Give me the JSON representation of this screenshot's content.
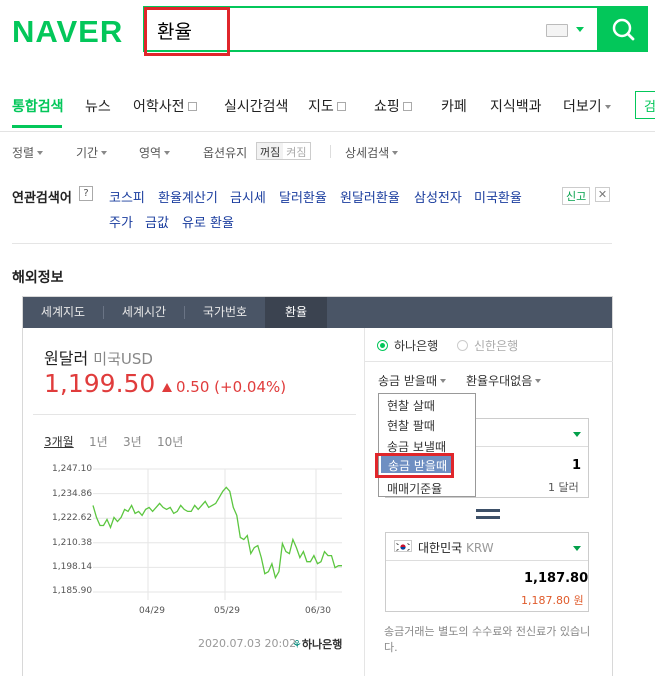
{
  "header": {
    "logo": "NAVER",
    "search_value": "환율",
    "brand_color": "#03c75a"
  },
  "nav": {
    "items": [
      {
        "label": "통합검색",
        "active": true
      },
      {
        "label": "뉴스"
      },
      {
        "label": "어학사전"
      },
      {
        "label": "실시간검색"
      },
      {
        "label": "지도"
      },
      {
        "label": "쇼핑"
      },
      {
        "label": "카페"
      },
      {
        "label": "지식백과"
      },
      {
        "label": "더보기"
      }
    ],
    "search_button_partial": "검"
  },
  "options": {
    "sort": "정렬",
    "period": "기간",
    "area": "영역",
    "keep_option": "옵션유지",
    "toggle_on": "꺼짐",
    "toggle_off": "켜짐",
    "detail_search": "상세검색"
  },
  "related": {
    "label": "연관검색어",
    "help": "?",
    "terms_row1": [
      "코스피",
      "환율계산기",
      "금시세",
      "달러환율",
      "원달러환율",
      "삼성전자",
      "미국환율"
    ],
    "terms_row2": [
      "주가",
      "금값",
      "유로 환율"
    ],
    "report": "신고",
    "close": "✕"
  },
  "section": {
    "title": "해외정보"
  },
  "widget": {
    "tabs": [
      "세계지도",
      "세계시간",
      "국가번호",
      "환율"
    ],
    "active_tab": 3,
    "currency_title": "원달러",
    "currency_sub": "미국USD",
    "price": "1,199.50",
    "change": "0.50 (+0.04%)",
    "up_color": "#e03c3c",
    "periods": [
      "3개월",
      "1년",
      "3년",
      "10년"
    ],
    "chart_footer_date": "2020.07.03 20:02",
    "bank_logo": "하나은행",
    "banks": [
      "하나은행",
      "신한은행"
    ],
    "selected_bank": "하나은행",
    "rate_type": "송금 받을때",
    "preferential": "환율우대없음",
    "rate_menu": [
      "현찰 살때",
      "현찰 팔때",
      "송금 보낼때",
      "송금 받을때",
      "매매기준율"
    ],
    "menu_highlight": "송금 받을때",
    "from_value": "1",
    "from_unit": "1 달러",
    "to_country": "대한민국",
    "to_code": "KRW",
    "to_value": "1,187.80",
    "to_unit": "1,187.80 원",
    "note": "송금거래는 별도의 수수료와 전신료가 있습니다."
  },
  "chart_data": {
    "type": "line",
    "title": "",
    "xlabel": "",
    "ylabel": "",
    "x_ticks": [
      "04/29",
      "05/29",
      "06/30"
    ],
    "y_ticks": [
      "1,247.10",
      "1,234.86",
      "1,222.62",
      "1,210.38",
      "1,198.14",
      "1,185.90"
    ],
    "ylim": [
      1185.9,
      1247.1
    ],
    "line_color": "#5cc640",
    "grid": true,
    "series": [
      {
        "values": [
          1229,
          1223,
          1219,
          1219,
          1222,
          1218,
          1223,
          1221,
          1223,
          1227,
          1226,
          1229,
          1225,
          1226,
          1224,
          1227,
          1228,
          1226,
          1228,
          1230,
          1228,
          1227,
          1228,
          1225,
          1226,
          1229,
          1227,
          1226,
          1226,
          1229,
          1227,
          1229,
          1231,
          1228,
          1229,
          1230,
          1233,
          1236,
          1238,
          1236,
          1228,
          1224,
          1213,
          1212,
          1214,
          1205,
          1208,
          1209,
          1203,
          1195,
          1196,
          1200,
          1193,
          1196,
          1210,
          1206,
          1205,
          1212,
          1208,
          1203,
          1206,
          1201,
          1201,
          1204,
          1200,
          1201,
          1206,
          1204,
          1204,
          1198,
          1199,
          1199
        ]
      }
    ]
  }
}
